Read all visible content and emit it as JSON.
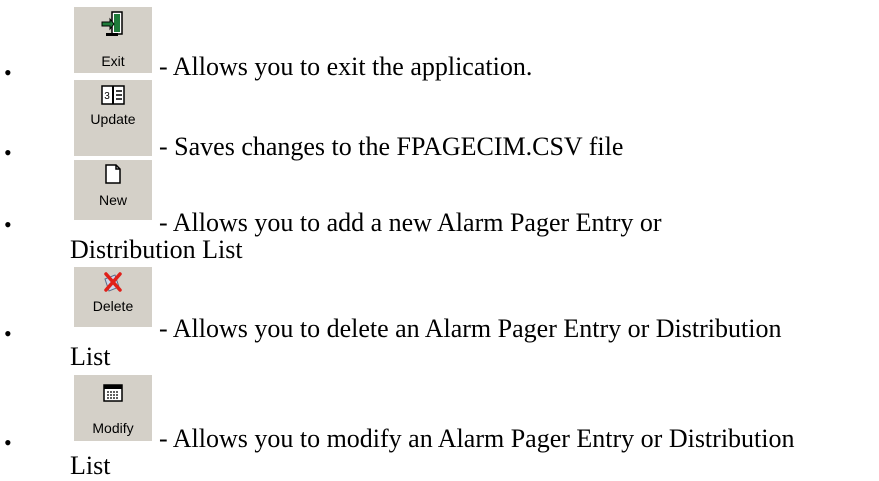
{
  "items": [
    {
      "button_label": "Exit",
      "icon": "exit-door-icon",
      "description": "- Allows you to exit the application.",
      "continuation": ""
    },
    {
      "button_label": "Update",
      "icon": "update-icon",
      "description": "- Saves changes to the FPAGECIM.CSV file",
      "continuation": ""
    },
    {
      "button_label": "New",
      "icon": "new-document-icon",
      "description": "- Allows you to add a new Alarm Pager Entry or",
      "continuation": "Distribution List"
    },
    {
      "button_label": "Delete",
      "icon": "delete-icon",
      "description": "- Allows you to delete an Alarm Pager Entry or Distribution",
      "continuation": "List"
    },
    {
      "button_label": "Modify",
      "icon": "modify-icon",
      "description": "- Allows you to modify an Alarm Pager Entry or Distribution",
      "continuation": "List"
    }
  ],
  "bullet": "•",
  "colors": {
    "button_face": "#d4d0c8",
    "delete_red": "#e0201a",
    "exit_green": "#1e7b3a"
  }
}
